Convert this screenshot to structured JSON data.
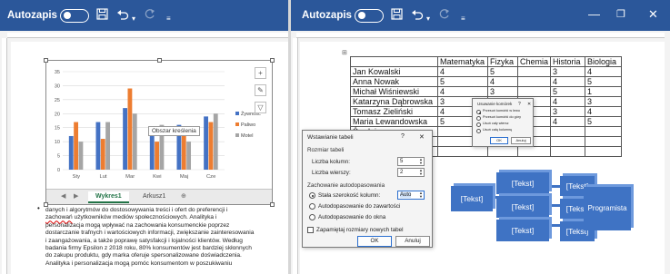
{
  "left_window": {
    "autosave_label": "Autozapis",
    "toolbar_icons": [
      "save-icon",
      "undo-icon",
      "redo-icon",
      "customize-icon"
    ]
  },
  "right_window": {
    "autosave_label": "Autozapis",
    "toolbar_icons": [
      "save-icon",
      "undo-icon",
      "redo-icon",
      "customize-icon"
    ],
    "window_controls": [
      "minimize-icon",
      "restore-icon",
      "close-icon"
    ]
  },
  "colors": {
    "titlebar": "#2b579a",
    "series_zywnosc": "#4472c4",
    "series_paliwo": "#ed7d31",
    "series_motel": "#a5a5a5"
  },
  "chart_sheet_tabs": [
    "Wykres1",
    "Arkusz1"
  ],
  "chart_tooltip": "Obszar kreślenia",
  "chart_data": {
    "type": "bar",
    "categories": [
      "Sty",
      "Lut",
      "Mar",
      "Kwi",
      "Maj",
      "Cze"
    ],
    "series": [
      {
        "name": "Żywność",
        "values": [
          12,
          17,
          22,
          15,
          16,
          19
        ]
      },
      {
        "name": "Paliwo",
        "values": [
          17,
          11,
          29,
          10,
          13,
          17
        ]
      },
      {
        "name": "Motel",
        "values": [
          10,
          17,
          20,
          16,
          10,
          20
        ]
      }
    ],
    "yticks": [
      "0",
      "5",
      "10",
      "15",
      "20",
      "25",
      "30",
      "35"
    ],
    "ylim": [
      0,
      35
    ],
    "grid": true,
    "legend_position": "right"
  },
  "paragraph": {
    "lines": [
      "danych i algorytmów do dostosowywania treści i ofert do preferencji i",
      "zachowań użytkowników mediów społecznościowych. Analityka i",
      "personalizacja mogą wpływać na zachowania konsumenckie poprzez",
      "dostarczanie trafnych i wartościowych informacji, zwiększanie zainteresowania",
      "i zaangażowania, a także poprawę satysfakcji i lojalności klientów. Według",
      "badania firmy Epsilon z 2018 roku, 80% konsumentów jest bardziej skłonnych",
      "do zakupu produktu, gdy marka oferuje spersonalizowane doświadczenia.",
      "Analityka i personalizacja mogą pomóc konsumentom w poszukiwaniu"
    ],
    "misspelled_word": "zachowań"
  },
  "grades_table": {
    "headers": [
      "",
      "Matematyka",
      "Fizyka",
      "Chemia",
      "Historia",
      "Biologia"
    ],
    "rows": [
      [
        "Jan Kowalski",
        "4",
        "5",
        "",
        "3",
        "4"
      ],
      [
        "Anna Nowak",
        "5",
        "4",
        "",
        "4",
        "5"
      ],
      [
        "Michał Wiśniewski",
        "4",
        "3",
        "",
        "5",
        "1"
      ],
      [
        "Katarzyna Dąbrowska",
        "3",
        "3",
        "",
        "4",
        "3"
      ],
      [
        "Tomasz Zieliński",
        "4",
        "4",
        "",
        "3",
        "4"
      ],
      [
        "Maria Lewandowska",
        "5",
        "5",
        "",
        "4",
        "5"
      ],
      [
        "Średnia",
        "",
        "",
        "",
        "",
        ""
      ],
      [
        "",
        "",
        "",
        "",
        "",
        ""
      ],
      [
        "",
        "",
        "",
        "",
        "",
        ""
      ]
    ]
  },
  "dialog_table": {
    "title": "Wstawianie tabeli",
    "help": "?",
    "close": "✕",
    "group_size": "Rozmiar tabeli",
    "columns_label": "Liczba kolumn:",
    "columns_value": "5",
    "rows_label": "Liczba wierszy:",
    "rows_value": "2",
    "group_autofit": "Zachowanie autodopasowania",
    "option_fixed": "Stała szerokość kolumn:",
    "option_fixed_value": "Auto",
    "option_contents": "Autodopasowanie do zawartości",
    "option_window": "Autodopasowanie do okna",
    "remember": "Zapamiętaj rozmiary nowych tabel",
    "ok": "OK",
    "cancel": "Anuluj"
  },
  "dialog_delete": {
    "title": "Usuwanie komórek",
    "help": "?",
    "close": "✕",
    "options": [
      "Przesuń komórki w lewo",
      "Przesuń komórki do góry",
      "Usuń cały wiersz",
      "Usuń całą kolumnę"
    ],
    "ok": "OK",
    "cancel": "Anuluj"
  },
  "smartart": {
    "level1": [
      "[Tekst]"
    ],
    "level2": [
      "[Tekst]",
      "[Tekst]",
      "[Tekst]"
    ],
    "level3": [
      "[Tekst]",
      "[Tekst]",
      "[Tekst]"
    ],
    "level4": [
      "Programista"
    ]
  }
}
